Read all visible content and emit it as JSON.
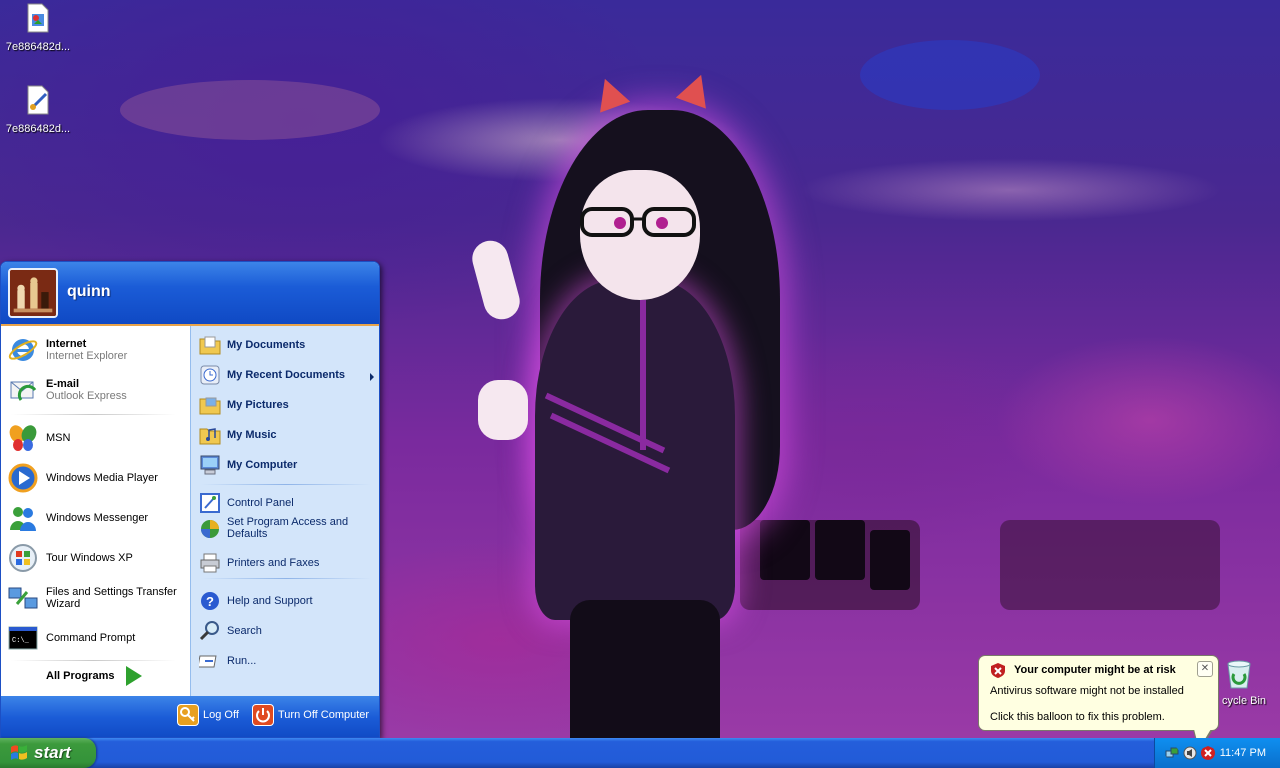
{
  "desktop": {
    "icons": [
      {
        "label": "7e886482d..."
      },
      {
        "label": "7e886482d..."
      }
    ],
    "recycle_bin_label": "cycle Bin"
  },
  "start_menu": {
    "username": "quinn",
    "pinned": [
      {
        "title": "Internet",
        "subtitle": "Internet Explorer",
        "icon": "internet-explorer-icon"
      },
      {
        "title": "E-mail",
        "subtitle": "Outlook Express",
        "icon": "outlook-express-icon"
      }
    ],
    "recent": [
      {
        "title": "MSN",
        "icon": "msn-butterfly-icon"
      },
      {
        "title": "Windows Media Player",
        "icon": "media-player-icon"
      },
      {
        "title": "Windows Messenger",
        "icon": "messenger-icon"
      },
      {
        "title": "Tour Windows XP",
        "icon": "tour-icon"
      },
      {
        "title": "Files and Settings Transfer",
        "title2": "Wizard",
        "icon": "transfer-wizard-icon"
      },
      {
        "title": "Command Prompt",
        "icon": "command-prompt-icon"
      }
    ],
    "all_programs": "All Programs",
    "places": [
      {
        "label": "My Documents",
        "icon": "folder-documents-icon"
      },
      {
        "label": "My Recent Documents",
        "icon": "recent-documents-icon"
      },
      {
        "label": "My Pictures",
        "icon": "folder-pictures-icon"
      },
      {
        "label": "My Music",
        "icon": "folder-music-icon"
      },
      {
        "label": "My Computer",
        "icon": "computer-icon"
      }
    ],
    "system": [
      {
        "label": "Control Panel",
        "icon": "control-panel-icon"
      },
      {
        "label": "Set Program Access and",
        "label2": "Defaults",
        "icon": "program-access-icon"
      },
      {
        "label": "Printers and Faxes",
        "icon": "printer-icon"
      }
    ],
    "help": [
      {
        "label": "Help and Support",
        "icon": "help-icon"
      },
      {
        "label": "Search",
        "icon": "search-icon"
      },
      {
        "label": "Run...",
        "icon": "run-icon"
      }
    ],
    "log_off": "Log Off",
    "turn_off": "Turn Off Computer"
  },
  "taskbar": {
    "start_label": "start",
    "clock": "11:47 PM"
  },
  "balloon": {
    "title": "Your computer might be at risk",
    "line1": "Antivirus software might not be installed",
    "line2": "Click this balloon to fix this problem.",
    "close_symbol": "✕"
  },
  "colors": {
    "taskbar_blue": "#245edb",
    "start_green": "#3c9a3c",
    "menu_header_blue": "#1b5cd7",
    "menu_right_pane": "#d3e5fa",
    "balloon_bg": "#ffffe1",
    "orange_separator": "#e8a34a"
  }
}
